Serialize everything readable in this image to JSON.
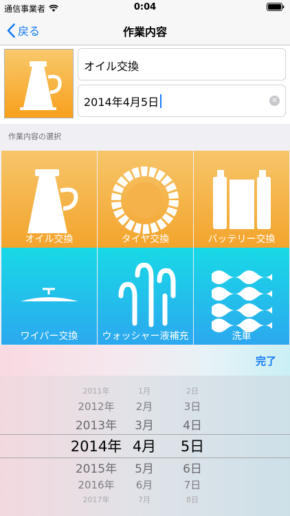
{
  "status_bar": {
    "carrier": "通信事業者",
    "time": "0:04"
  },
  "nav": {
    "back_label": "戻る",
    "title": "作業内容"
  },
  "form": {
    "name_value": "オイル交換",
    "date_value": "2014年4月5日"
  },
  "section_label": "作業内容の選択",
  "tiles": [
    {
      "label": "オイル交換",
      "icon": "oil-can-icon"
    },
    {
      "label": "タイヤ交換",
      "icon": "tire-icon"
    },
    {
      "label": "バッテリー交換",
      "icon": "battery-icon"
    },
    {
      "label": "ワイパー交換",
      "icon": "wiper-icon"
    },
    {
      "label": "ウォッシャー液補充",
      "icon": "washer-fluid-icon"
    },
    {
      "label": "洗車",
      "icon": "car-wash-icon"
    }
  ],
  "toolbar": {
    "done_label": "完了"
  },
  "picker": {
    "years": [
      "2011年",
      "2012年",
      "2013年",
      "2014年",
      "2015年",
      "2016年",
      "2017年"
    ],
    "months": [
      "1月",
      "2月",
      "3月",
      "4月",
      "5月",
      "6月",
      "7月"
    ],
    "days": [
      "2日",
      "3日",
      "4日",
      "5日",
      "6日",
      "7日",
      "8日"
    ],
    "selected": {
      "year": "2014年",
      "month": "4月",
      "day": "5日"
    }
  },
  "colors": {
    "accent": "#1479f5",
    "tile_orange": "#f3a42c",
    "tile_cyan": "#18d9e6"
  }
}
